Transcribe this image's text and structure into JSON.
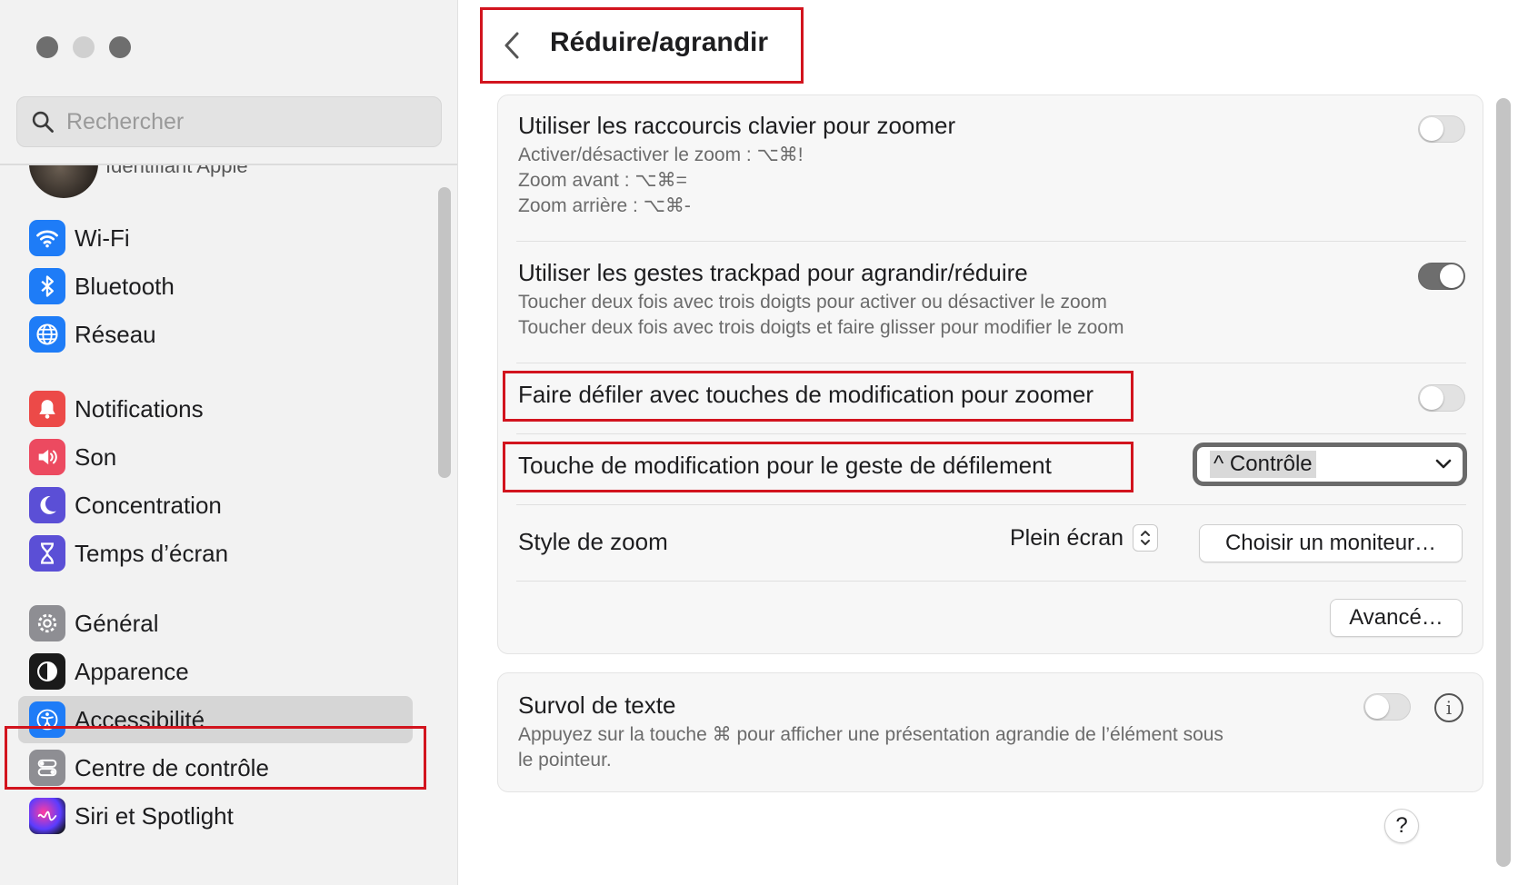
{
  "window": {
    "title": "Réduire/agrandir",
    "back_label": "‹"
  },
  "sidebar": {
    "search_placeholder": "Rechercher",
    "account_label": "Identifiant Apple",
    "items": [
      {
        "label": "Wi-Fi",
        "icon": "wifi-icon",
        "color": "#1e7cf7"
      },
      {
        "label": "Bluetooth",
        "icon": "bluetooth-icon",
        "color": "#1e7cf7"
      },
      {
        "label": "Réseau",
        "icon": "globe-icon",
        "color": "#1e7cf7"
      },
      {
        "label": "Notifications",
        "icon": "bell-icon",
        "color": "#ec4a48"
      },
      {
        "label": "Son",
        "icon": "speaker-icon",
        "color": "#ec4a60"
      },
      {
        "label": "Concentration",
        "icon": "moon-icon",
        "color": "#5b4fd6"
      },
      {
        "label": "Temps d’écran",
        "icon": "hourglass-icon",
        "color": "#5b4fd6"
      },
      {
        "label": "Général",
        "icon": "gear-icon",
        "color": "#8e8e93"
      },
      {
        "label": "Apparence",
        "icon": "appearance-icon",
        "color": "#1a1a1a"
      },
      {
        "label": "Accessibilité",
        "icon": "accessibility-icon",
        "color": "#1e7cf7",
        "selected": true
      },
      {
        "label": "Centre de contrôle",
        "icon": "control-center-icon",
        "color": "#8e8e93"
      },
      {
        "label": "Siri et Spotlight",
        "icon": "siri-icon",
        "color": "#2b2b3a"
      }
    ]
  },
  "main": {
    "keyboard_shortcuts": {
      "title": "Utiliser les raccourcis clavier pour zoomer",
      "lines": [
        "Activer/désactiver le zoom : ⌥⌘!",
        "Zoom avant : ⌥⌘=",
        "Zoom arrière : ⌥⌘-"
      ],
      "enabled": false
    },
    "trackpad_gestures": {
      "title": "Utiliser les gestes trackpad pour agrandir/réduire",
      "lines": [
        "Toucher deux fois avec trois doigts pour activer ou désactiver le zoom",
        "Toucher deux fois avec trois doigts et faire glisser pour modifier le zoom"
      ],
      "enabled": true
    },
    "scroll_modifier": {
      "title": "Faire défiler avec touches de modification pour zoomer",
      "enabled": false
    },
    "modifier_key": {
      "title": "Touche de modification pour le geste de défilement",
      "value": "^ Contrôle"
    },
    "zoom_style": {
      "title": "Style de zoom",
      "value": "Plein écran",
      "choose_display_label": "Choisir un moniteur…"
    },
    "advanced_label": "Avancé…",
    "hover_text": {
      "title": "Survol de texte",
      "lines": [
        "Appuyez sur la touche ⌘ pour afficher une présentation agrandie de l’élément sous",
        "le pointeur."
      ],
      "enabled": false,
      "info_label": "i"
    },
    "help_label": "?"
  },
  "colors": {
    "highlight": "#d2141e",
    "sidebar_bg": "#f2f2f2",
    "toggle_on": "#6e6e6e"
  }
}
